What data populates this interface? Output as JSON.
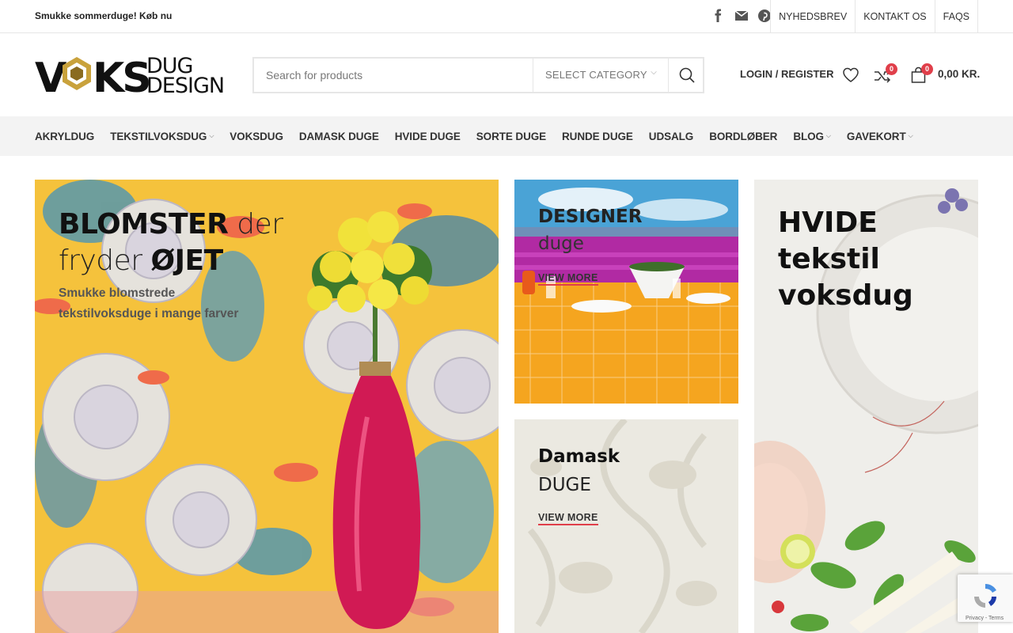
{
  "topbar": {
    "promo": "Smukke sommerduge! Køb nu",
    "social": [
      "facebook-icon",
      "email-icon",
      "pinterest-icon"
    ],
    "links": [
      "NYHEDSBREV",
      "KONTAKT OS",
      "FAQS"
    ]
  },
  "header": {
    "logo_text_main": "VOKS",
    "logo_text_top": "DUG",
    "logo_text_bottom": "DESIGN",
    "search": {
      "placeholder": "Search for products",
      "category": "SELECT CATEGORY"
    },
    "login": "LOGIN / REGISTER",
    "compare_count": "0",
    "cart_count": "0",
    "cart_total": "0,00 KR."
  },
  "nav": {
    "items": [
      {
        "label": "AKRYLDUG",
        "chevron": false
      },
      {
        "label": "TEKSTILVOKSDUG",
        "chevron": true
      },
      {
        "label": "VOKSDUG",
        "chevron": false
      },
      {
        "label": "DAMASK DUGE",
        "chevron": false
      },
      {
        "label": "HVIDE DUGE",
        "chevron": false
      },
      {
        "label": "SORTE DUGE",
        "chevron": false
      },
      {
        "label": "RUNDE DUGE",
        "chevron": false
      },
      {
        "label": "UDSALG",
        "chevron": false
      },
      {
        "label": "BORDLØBER",
        "chevron": false
      },
      {
        "label": "BLOG",
        "chevron": true
      },
      {
        "label": "GAVEKORT",
        "chevron": true
      }
    ]
  },
  "banners": {
    "flowers": {
      "bold1": "BLOMSTER",
      "light1": " der",
      "light2": "fryder ",
      "bold2": "ØJET",
      "subtitle": "Smukke blomstrede tekstilvoksduge i mange farver"
    },
    "designer": {
      "title": "DESIGNER",
      "subtitle": "duge",
      "cta": "VIEW MORE"
    },
    "damask": {
      "title": "Damask",
      "subtitle": "DUGE",
      "cta": "VIEW MORE"
    },
    "white": {
      "title": "HVIDE tekstil voksdug"
    }
  },
  "recaptcha": {
    "links": "Privacy - Terms"
  },
  "colors": {
    "accent": "#e03f4a",
    "nav_bg": "#f3f3f3"
  }
}
